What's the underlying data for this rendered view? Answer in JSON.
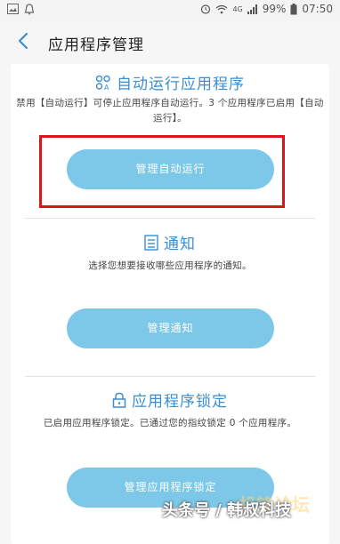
{
  "status_bar": {
    "network": "4G",
    "battery": "99%",
    "time": "07:50"
  },
  "header": {
    "title": "应用程序管理"
  },
  "sections": [
    {
      "heading": "自动运行应用程序",
      "description": "禁用【自动运行】可停止应用程序自动运行。3 个应用程序已启用【自动运行】。",
      "button": "管理自动运行"
    },
    {
      "heading": "通知",
      "description": "选择您想要接收哪些应用程序的通知。",
      "button": "管理通知"
    },
    {
      "heading": "应用程序锁定",
      "description": "已启用应用程序锁定。已通过您的指纹锁定 0 个应用程序。",
      "button": "管理应用程序锁定"
    }
  ],
  "watermark": {
    "text": "头条号 / 韩叔科技",
    "faint_text": "机锋论坛"
  },
  "colors": {
    "accent": "#3a8fd0",
    "button": "#7dc8e8",
    "highlight_border": "#d8171c"
  }
}
